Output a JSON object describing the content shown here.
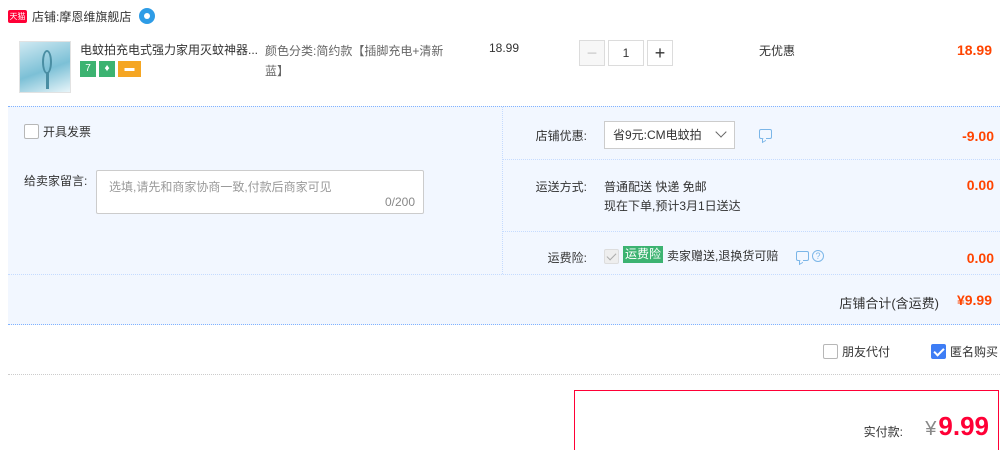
{
  "shop": {
    "platform_badge": "天猫",
    "label": "店铺:",
    "name": "摩恩维旗舰店"
  },
  "item": {
    "title": "电蚊拍充电式强力家用灭蚊神器...",
    "tags": [
      "7",
      "shield",
      "card"
    ],
    "sku_label": "颜色分类:",
    "sku_value": "简约款【插脚充电+清新蓝】",
    "unit_price": "18.99",
    "quantity": "1",
    "qty_minus": "−",
    "qty_plus": "+",
    "discount": "无优惠",
    "subtotal": "18.99"
  },
  "options": {
    "invoice_label": "开具发票",
    "memo_label": "给卖家留言:",
    "memo_placeholder": "选填,请先和商家协商一致,付款后商家可见",
    "memo_count": "0/200",
    "shop_coupon": {
      "label": "店铺优惠:",
      "selected": "省9元:CM电蚊拍",
      "amount": "-9.00"
    },
    "shipping": {
      "label": "运送方式:",
      "method": "普通配送 快递 免邮",
      "eta": "现在下单,预计3月1日送达",
      "amount": "0.00"
    },
    "insurance": {
      "label": "运费险:",
      "badge": "运费险",
      "text": "卖家赠送,退换货可赔",
      "amount": "0.00"
    },
    "shop_total_label": "店铺合计(含运费)",
    "shop_total": "¥9.99"
  },
  "bottom_options": {
    "friend_pay": "朋友代付",
    "anonymous": "匿名购买",
    "anonymous_checked": true,
    "friend_pay_checked": false
  },
  "payment": {
    "label": "实付款:",
    "currency": "¥",
    "amount": "9.99"
  },
  "colors": {
    "accent_red": "#ff0036",
    "price_orange": "#ff4400",
    "panel_blue": "#f2f7ff",
    "check_blue": "#3e7df5",
    "badge_green": "#3cb371"
  }
}
